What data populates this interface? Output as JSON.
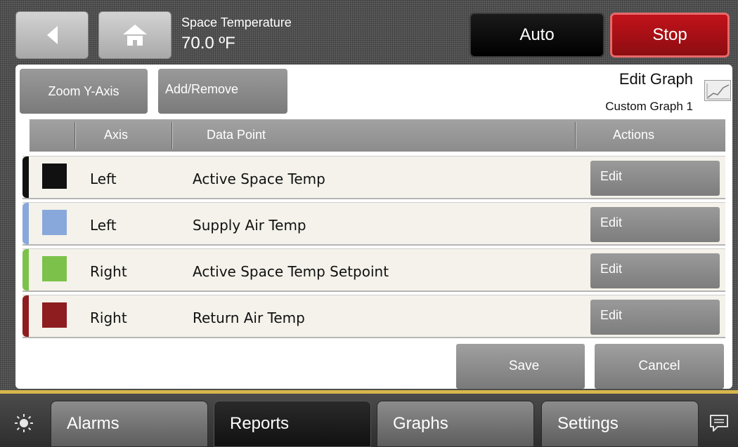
{
  "header": {
    "point_name": "Space Temperature",
    "point_value": "70.0 ºF",
    "auto_label": "Auto",
    "stop_label": "Stop",
    "stop_color": "#c2121a"
  },
  "toolbar": {
    "zoom_label": "Zoom Y-Axis",
    "addremove_label": "Add/Remove",
    "title": "Edit Graph",
    "graph_name": "Custom Graph 1"
  },
  "table": {
    "headers": {
      "axis": "Axis",
      "point": "Data Point",
      "actions": "Actions"
    },
    "rows": [
      {
        "axis": "Left",
        "point": "Active Space Temp",
        "edit": "Edit",
        "color": "#111111"
      },
      {
        "axis": "Left",
        "point": "Supply Air Temp",
        "edit": "Edit",
        "color": "#88a8dc"
      },
      {
        "axis": "Right",
        "point": "Active Space Temp Setpoint",
        "edit": "Edit",
        "color": "#7cc24a"
      },
      {
        "axis": "Right",
        "point": "Return Air Temp",
        "edit": "Edit",
        "color": "#8e1d1f"
      }
    ]
  },
  "actions": {
    "save_label": "Save",
    "cancel_label": "Cancel"
  },
  "nav": {
    "tabs": [
      {
        "label": "Alarms"
      },
      {
        "label": "Reports"
      },
      {
        "label": "Graphs"
      },
      {
        "label": "Settings"
      }
    ],
    "active_tab": "Reports"
  },
  "icons": [
    "back-arrow-icon",
    "home-icon",
    "graph-icon",
    "sun-icon",
    "message-icon"
  ]
}
